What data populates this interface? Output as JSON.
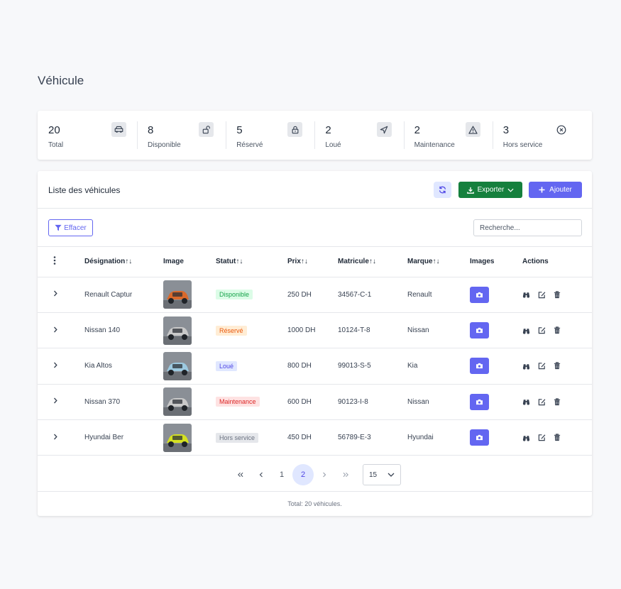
{
  "page": {
    "title": "Véhicule"
  },
  "stats": [
    {
      "value": "20",
      "label": "Total",
      "icon": "car-icon"
    },
    {
      "value": "8",
      "label": "Disponible",
      "icon": "unlock-icon"
    },
    {
      "value": "5",
      "label": "Réservé",
      "icon": "lock-icon"
    },
    {
      "value": "2",
      "label": "Loué",
      "icon": "send-icon"
    },
    {
      "value": "2",
      "label": "Maintenance",
      "icon": "warning-icon"
    },
    {
      "value": "3",
      "label": "Hors service",
      "icon": "x-circle-icon"
    }
  ],
  "list": {
    "title": "Liste des véhicules",
    "export_label": "Exporter",
    "add_label": "Ajouter",
    "clear_label": "Effacer",
    "search_placeholder": "Recherche..."
  },
  "table": {
    "columns": [
      "Désignation↑↓",
      "Image",
      "Statut↑↓",
      "Prix↑↓",
      "Matricule↑↓",
      "Marque↑↓",
      "Images",
      "Actions"
    ],
    "rows": [
      {
        "designation": "Renault Captur",
        "status": "Disponible",
        "status_color": "#16a34a",
        "status_bg": "#dcfce7",
        "price": "250 DH",
        "plate": "34567-C-1",
        "brand": "Renault",
        "car_color": "#d9692b"
      },
      {
        "designation": "Nissan 140",
        "status": "Réservé",
        "status_color": "#ea580c",
        "status_bg": "#ffedd5",
        "price": "1000 DH",
        "plate": "10124-T-8",
        "brand": "Nissan",
        "car_color": "#c9c9c9"
      },
      {
        "designation": "Kia Altos",
        "status": "Loué",
        "status_color": "#4f46e5",
        "status_bg": "#e0e7ff",
        "price": "800 DH",
        "plate": "99013-S-5",
        "brand": "Kia",
        "car_color": "#9cc9e0"
      },
      {
        "designation": "Nissan 370",
        "status": "Maintenance",
        "status_color": "#dc2626",
        "status_bg": "#fee2e2",
        "price": "600 DH",
        "plate": "90123-I-8",
        "brand": "Nissan",
        "car_color": "#c9c9c9"
      },
      {
        "designation": "Hyundai Ber",
        "status": "Hors service",
        "status_color": "#6b7280",
        "status_bg": "#e5e7eb",
        "price": "450 DH",
        "plate": "56789-E-3",
        "brand": "Hyundai",
        "car_color": "#d4e021"
      }
    ]
  },
  "pagination": {
    "pages": [
      "1",
      "2"
    ],
    "current_page": "2",
    "per_page": "15"
  },
  "footer": {
    "total_text": "Total: 20 véhicules."
  },
  "colors": {
    "primary": "#6366f1",
    "export": "#15803d"
  }
}
